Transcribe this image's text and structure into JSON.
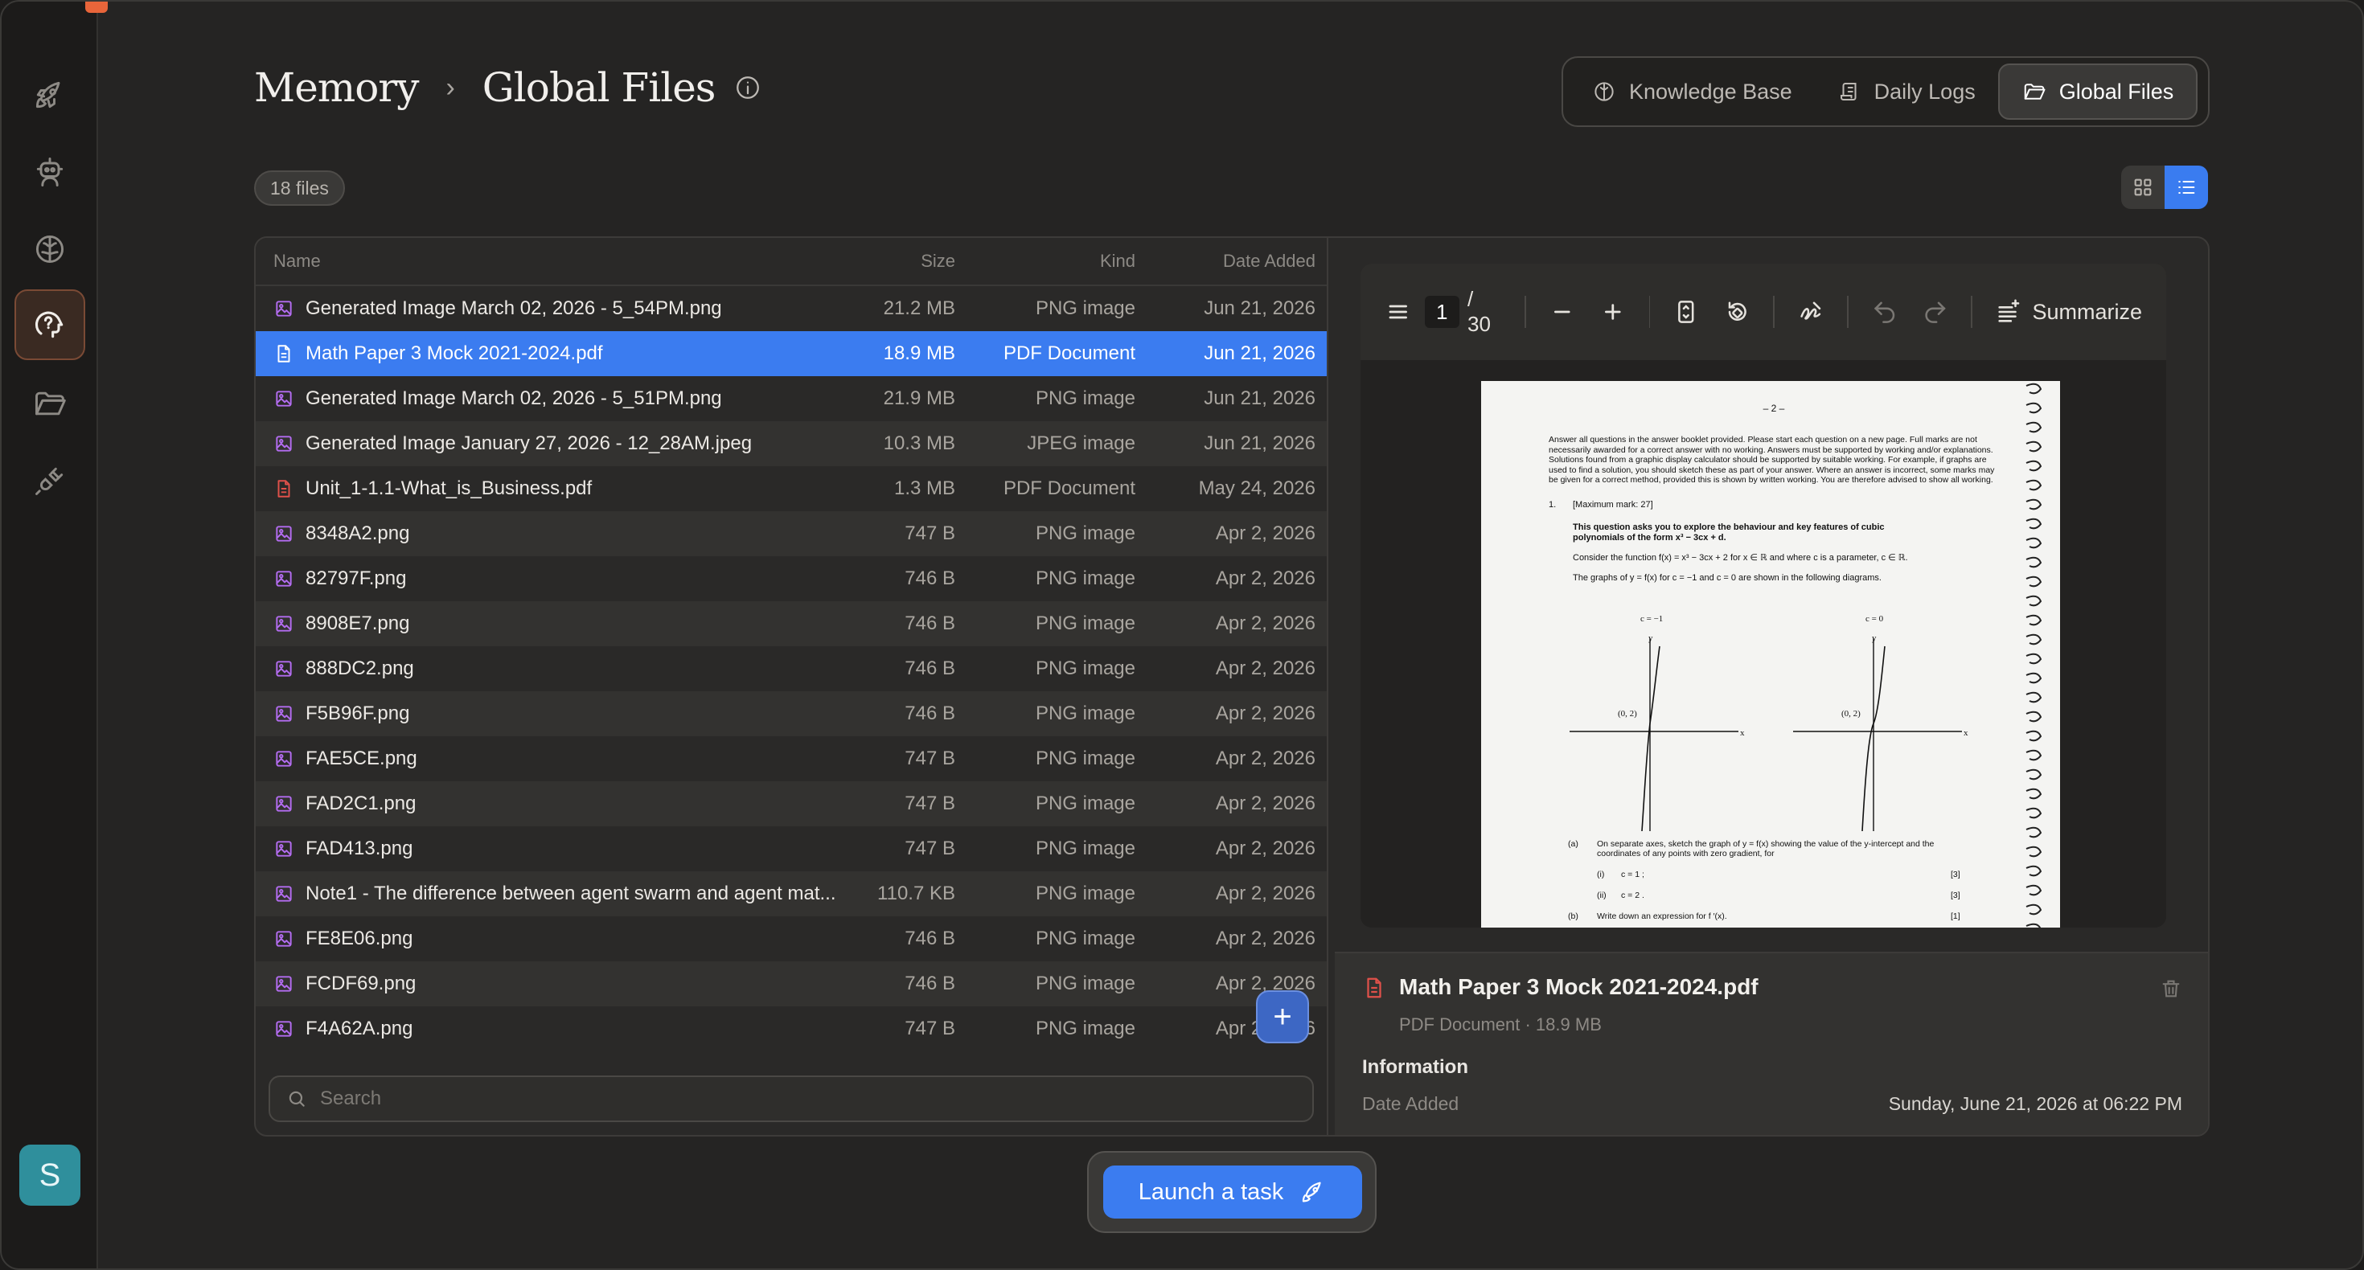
{
  "sidebar": {
    "items": [
      {
        "icon": "rocket-icon"
      },
      {
        "icon": "robot-icon"
      },
      {
        "icon": "brain-icon"
      },
      {
        "icon": "memory-icon",
        "active": true
      },
      {
        "icon": "folder-icon"
      },
      {
        "icon": "plug-icon"
      }
    ],
    "avatar_initial": "S"
  },
  "header": {
    "breadcrumb_root": "Memory",
    "breadcrumb_sep": "›",
    "page_title": "Global Files"
  },
  "top_tabs": [
    {
      "label": "Knowledge Base",
      "icon": "brain-icon"
    },
    {
      "label": "Daily Logs",
      "icon": "scroll-icon"
    },
    {
      "label": "Global Files",
      "icon": "folder-icon",
      "active": true
    }
  ],
  "file_count": "18 files",
  "columns": {
    "name": "Name",
    "size": "Size",
    "kind": "Kind",
    "date": "Date Added"
  },
  "files": [
    {
      "name": "Generated Image March 02, 2026 - 5_54PM.png",
      "size": "21.2 MB",
      "kind": "PNG image",
      "date": "Jun 21, 2026",
      "type": "image"
    },
    {
      "name": "Math Paper 3 Mock 2021-2024.pdf",
      "size": "18.9 MB",
      "kind": "PDF Document",
      "date": "Jun 21, 2026",
      "type": "pdf",
      "selected": true
    },
    {
      "name": "Generated Image March 02, 2026 - 5_51PM.png",
      "size": "21.9 MB",
      "kind": "PNG image",
      "date": "Jun 21, 2026",
      "type": "image"
    },
    {
      "name": "Generated Image January 27, 2026 - 12_28AM.jpeg",
      "size": "10.3 MB",
      "kind": "JPEG image",
      "date": "Jun 21, 2026",
      "type": "image"
    },
    {
      "name": "Unit_1-1.1-What_is_Business.pdf",
      "size": "1.3 MB",
      "kind": "PDF Document",
      "date": "May 24, 2026",
      "type": "pdf"
    },
    {
      "name": "8348A2.png",
      "size": "747 B",
      "kind": "PNG image",
      "date": "Apr 2, 2026",
      "type": "image"
    },
    {
      "name": "82797F.png",
      "size": "746 B",
      "kind": "PNG image",
      "date": "Apr 2, 2026",
      "type": "image"
    },
    {
      "name": "8908E7.png",
      "size": "746 B",
      "kind": "PNG image",
      "date": "Apr 2, 2026",
      "type": "image"
    },
    {
      "name": "888DC2.png",
      "size": "746 B",
      "kind": "PNG image",
      "date": "Apr 2, 2026",
      "type": "image"
    },
    {
      "name": "F5B96F.png",
      "size": "746 B",
      "kind": "PNG image",
      "date": "Apr 2, 2026",
      "type": "image"
    },
    {
      "name": "FAE5CE.png",
      "size": "747 B",
      "kind": "PNG image",
      "date": "Apr 2, 2026",
      "type": "image"
    },
    {
      "name": "FAD2C1.png",
      "size": "747 B",
      "kind": "PNG image",
      "date": "Apr 2, 2026",
      "type": "image"
    },
    {
      "name": "FAD413.png",
      "size": "747 B",
      "kind": "PNG image",
      "date": "Apr 2, 2026",
      "type": "image"
    },
    {
      "name": "Note1 - The difference between agent swarm and agent mat...",
      "size": "110.7 KB",
      "kind": "PNG image",
      "date": "Apr 2, 2026",
      "type": "image"
    },
    {
      "name": "FE8E06.png",
      "size": "746 B",
      "kind": "PNG image",
      "date": "Apr 2, 2026",
      "type": "image"
    },
    {
      "name": "FCDF69.png",
      "size": "746 B",
      "kind": "PNG image",
      "date": "Apr 2, 2026",
      "type": "image"
    },
    {
      "name": "F4A62A.png",
      "size": "747 B",
      "kind": "PNG image",
      "date": "Apr 2, 2026",
      "type": "image"
    }
  ],
  "search": {
    "placeholder": "Search"
  },
  "fab_label": "+",
  "pdf_viewer": {
    "current_page": "1",
    "total_pages": "/ 30",
    "summarize_label": "Summarize",
    "page": {
      "header": "– 2 –",
      "intro": "Answer all questions in the answer booklet provided. Please start each question on a new page. Full marks are not necessarily awarded for a correct answer with no working. Answers must be supported by working and/or explanations. Solutions found from a graphic display calculator should be supported by suitable working. For example, if graphs are used to find a solution, you should sketch these as part of your answer. Where an answer is incorrect, some marks may be given for a correct method, provided this is shown by written working. You are therefore advised to show all working.",
      "q_num": "1.",
      "q_marks": "[Maximum mark: 27]",
      "q_text": "This question asks you to explore the behaviour and key features of cubic polynomials of the form x³ − 3cx + d.",
      "consider": "Consider the function f(x) = x³ − 3cx + 2 for x ∈ ℝ and where c is a parameter, c ∈ ℝ.",
      "graphs_line": "The graphs of y = f(x) for c = −1 and c = 0 are shown in the following diagrams.",
      "graph1_label": "c = −1",
      "graph2_label": "c = 0",
      "axis_y": "y",
      "axis_x": "x",
      "point": "(0, 2)",
      "part_a": "(a)",
      "part_a_text": "On separate axes, sketch the graph of y = f(x) showing the value of the y-intercept and the coordinates of any points with zero gradient, for",
      "part_i": "(i)",
      "part_i_text": "c = 1 ;",
      "part_i_marks": "[3]",
      "part_ii": "(ii)",
      "part_ii_text": "c = 2 .",
      "part_ii_marks": "[3]",
      "part_b": "(b)",
      "part_b_text": "Write down an expression for f ′(x).",
      "part_b_marks": "[1]"
    }
  },
  "details": {
    "file_name": "Math Paper 3 Mock 2021-2024.pdf",
    "subtitle": "PDF Document · 18.9 MB",
    "section_title": "Information",
    "date_key": "Date Added",
    "date_value": "Sunday, June 21, 2026 at 06:22 PM"
  },
  "launch": {
    "label": "Launch a task"
  },
  "colors": {
    "accent": "#3b7cf0",
    "image_icon": "#b36cf0",
    "pdf_icon": "#e0514a",
    "active_nav": "#e8653a"
  }
}
